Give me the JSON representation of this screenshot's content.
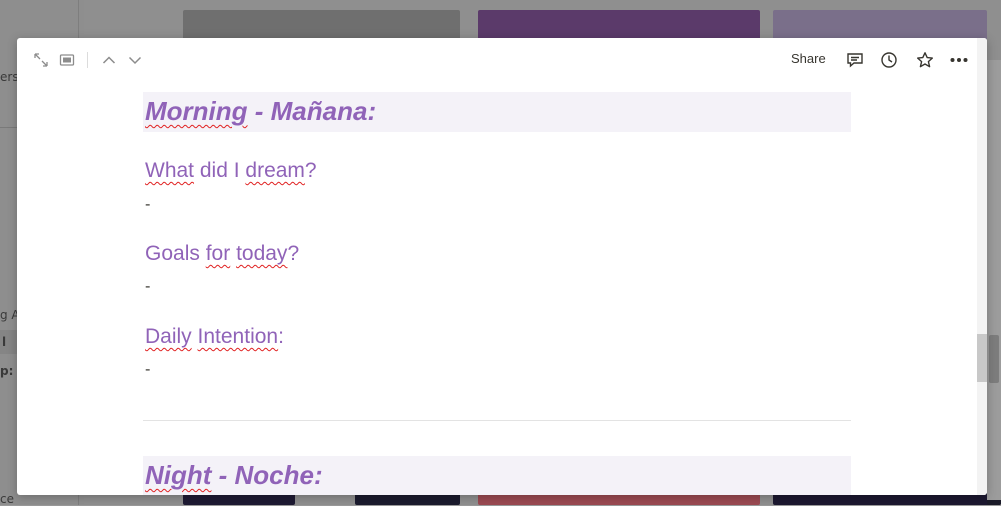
{
  "background": {
    "left_fragments": [
      "ers",
      "g A",
      "l",
      "p:",
      "ce"
    ]
  },
  "toolbar": {
    "expand_icon": "expand-arrows",
    "page_icon": "page-layout",
    "up_icon": "chevron-up",
    "down_icon": "chevron-down",
    "share_label": "Share",
    "comments_icon": "comment",
    "history_icon": "clock",
    "favorite_icon": "star",
    "more_icon": "ellipsis"
  },
  "doc": {
    "morning_heading_1": "Morning",
    "morning_heading_2": " - Mañana:",
    "dream_q_1": "What",
    "dream_q_2": " did I ",
    "dream_q_3": "dream",
    "dream_q_4": "?",
    "dream_answer": "-",
    "goals_q_1": "Goals ",
    "goals_q_2": "for",
    "goals_q_3": " ",
    "goals_q_4": "today",
    "goals_q_5": "?",
    "goals_answer": "-",
    "intention_1": "Daily",
    "intention_2": " ",
    "intention_3": "Intention",
    "intention_4": ":",
    "intention_answer": "-",
    "night_heading_1": "Night",
    "night_heading_2": " - Noche:"
  },
  "colors": {
    "heading": "#9063b8",
    "heading_band": "#f4f2f8",
    "spellcheck": "#e02020"
  }
}
